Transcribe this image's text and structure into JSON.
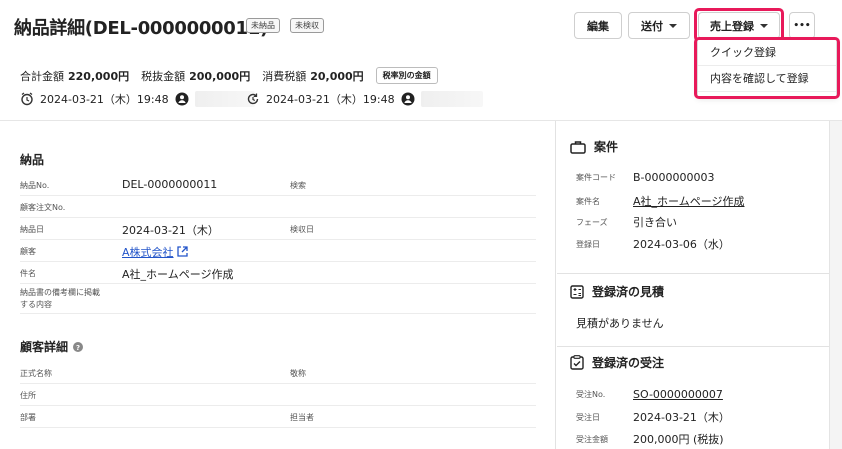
{
  "header": {
    "title": "納品詳細(DEL-0000000011)",
    "badges": [
      "未納品",
      "未検収"
    ],
    "buttons": {
      "edit": "編集",
      "send": "送付",
      "sales": "売上登録",
      "more": "•••"
    },
    "menu": [
      "クイック登録",
      "内容を確認して登録"
    ],
    "totals": {
      "total_label": "合計金額",
      "total_value": "220,000円",
      "pretax_label": "税抜金額",
      "pretax_value": "200,000円",
      "tax_label": "消費税額",
      "tax_value": "20,000円",
      "tax_rate_button": "税率別の金額"
    },
    "created": "2024-03-21（木）19:48",
    "updated": "2024-03-21（木）19:48"
  },
  "delivery": {
    "title": "納品",
    "rows": [
      {
        "label": "納品No.",
        "value": "DEL-0000000011",
        "label2": "検索"
      },
      {
        "label": "顧客注文No.",
        "value": "",
        "label2": ""
      },
      {
        "label": "納品日",
        "value": "2024-03-21（木）",
        "label2": "検収日"
      },
      {
        "label": "顧客",
        "value": "A株式会社",
        "label2": ""
      },
      {
        "label": "件名",
        "value": "A社_ホームページ作成",
        "label2": ""
      }
    ],
    "note_label_1": "納品書の備考欄に掲載",
    "note_label_2": "する内容"
  },
  "customer": {
    "title": "顧客詳細",
    "rows": [
      {
        "label": "正式名称",
        "label2": "敬称"
      },
      {
        "label": "住所",
        "label2": ""
      },
      {
        "label": "部署",
        "label2": "担当者"
      }
    ]
  },
  "project": {
    "title": "案件",
    "rows": [
      {
        "k": "案件コード",
        "v": "B-0000000003"
      },
      {
        "k": "案件名",
        "v": "A社_ホームページ作成"
      },
      {
        "k": "フェーズ",
        "v": "引き合い"
      },
      {
        "k": "登録日",
        "v": "2024-03-06（水）"
      }
    ]
  },
  "estimates": {
    "title": "登録済の見積",
    "empty": "見積がありません"
  },
  "orders": {
    "title": "登録済の受注",
    "rows": [
      {
        "k": "受注No.",
        "v": "SO-0000000007"
      },
      {
        "k": "受注日",
        "v": "2024-03-21（木）"
      },
      {
        "k": "受注金額",
        "v": "200,000円 (税抜)"
      }
    ]
  },
  "colors": {
    "highlight": "#e8195a",
    "link": "#2355c9"
  }
}
